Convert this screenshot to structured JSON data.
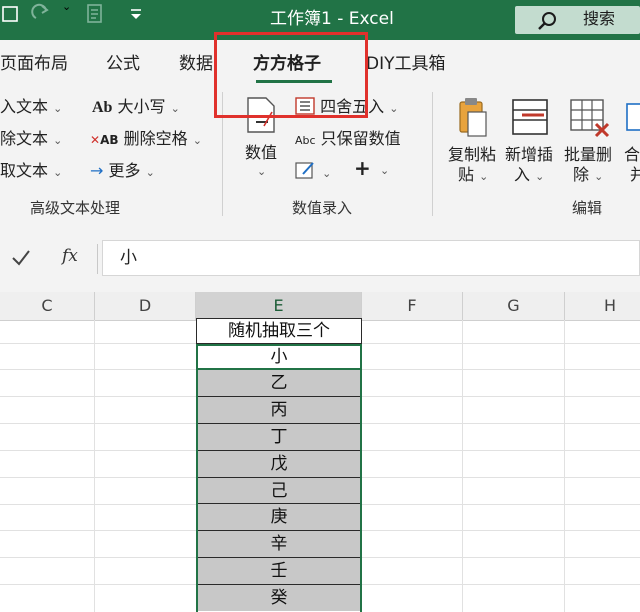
{
  "titlebar": {
    "title": "工作簿1  -  Excel",
    "search_label": "搜索"
  },
  "tabs": [
    {
      "label": "页面布局"
    },
    {
      "label": "公式"
    },
    {
      "label": "数据"
    },
    {
      "label": "方方格子",
      "active": true
    },
    {
      "label": "DIY工具箱"
    }
  ],
  "ribbon": {
    "text_group": {
      "items": [
        "入文本",
        "除文本",
        "取文本"
      ],
      "label": "高级文本处理"
    },
    "case_button": "大小写",
    "delete_space_button": "删除空格",
    "more_button": "更多",
    "value_button": "数值",
    "round_button": "四舍五入",
    "keep_value_button": "只保留数值",
    "value_group_label": "数值录入",
    "edit_group": {
      "copy_paste": [
        "复制粘",
        "贴"
      ],
      "insert": [
        "新增插",
        "入"
      ],
      "batch_delete": [
        "批量删",
        "除"
      ],
      "merge": [
        "合",
        "并"
      ],
      "label": "编辑"
    }
  },
  "formula_bar": {
    "fx_label": "fx",
    "value": "小"
  },
  "columns": [
    "C",
    "D",
    "E",
    "F",
    "G",
    "H"
  ],
  "selected_column": "E",
  "cells": {
    "header": "随机抽取三个",
    "values": [
      "小",
      "乙",
      "丙",
      "丁",
      "戊",
      "己",
      "庚",
      "辛",
      "壬",
      "癸"
    ]
  },
  "colors": {
    "excel_green": "#217346",
    "highlight_red": "#e0312c",
    "selection_gray": "#c8c8c8"
  }
}
